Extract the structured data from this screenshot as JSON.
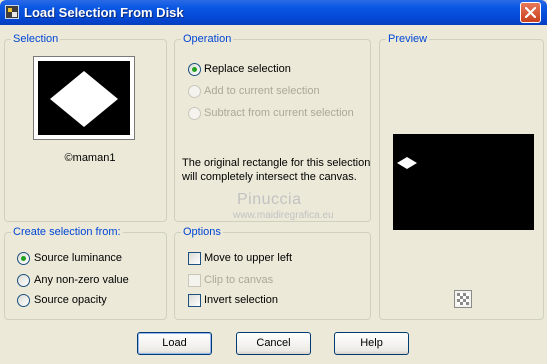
{
  "window": {
    "title": "Load Selection From Disk"
  },
  "selection": {
    "legend": "Selection",
    "thumbnail_label": "©maman1"
  },
  "operation": {
    "legend": "Operation",
    "options": [
      {
        "label": "Replace selection",
        "checked": true,
        "enabled": true
      },
      {
        "label": "Add to current selection",
        "checked": false,
        "enabled": false
      },
      {
        "label": "Subtract from current selection",
        "checked": false,
        "enabled": false
      }
    ],
    "info_text": "The original rectangle for this selection will completely intersect the canvas."
  },
  "preview": {
    "legend": "Preview"
  },
  "watermark": {
    "name": "Pinuccia",
    "url": "www.maidiregrafica.eu"
  },
  "create_from": {
    "legend": "Create selection from:",
    "options": [
      {
        "label": "Source luminance",
        "checked": true
      },
      {
        "label": "Any non-zero value",
        "checked": false
      },
      {
        "label": "Source opacity",
        "checked": false
      }
    ]
  },
  "options": {
    "legend": "Options",
    "items": [
      {
        "label": "Move to upper left",
        "checked": false,
        "enabled": true
      },
      {
        "label": "Clip to canvas",
        "checked": false,
        "enabled": false
      },
      {
        "label": "Invert selection",
        "checked": false,
        "enabled": true
      }
    ]
  },
  "buttons": {
    "load": "Load",
    "cancel": "Cancel",
    "help": "Help"
  },
  "colors": {
    "legend_blue": "#0046d5",
    "titlebar_blue": "#0449d6",
    "radio_green": "#21a121"
  }
}
